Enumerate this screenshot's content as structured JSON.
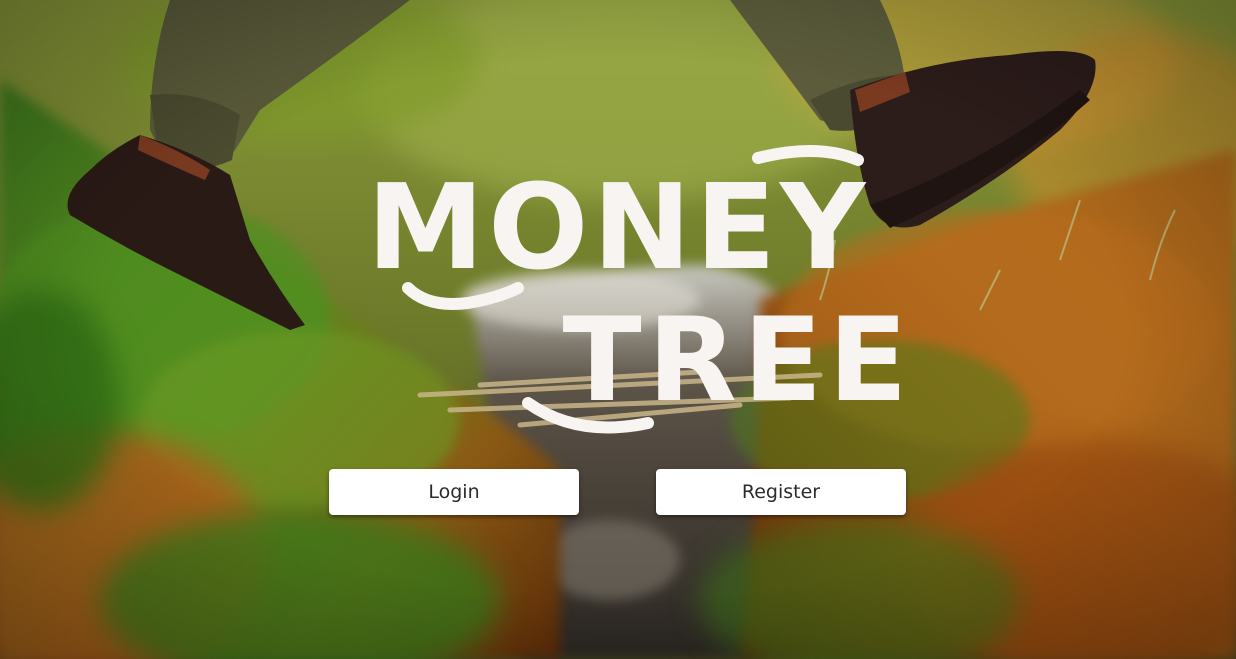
{
  "brand": {
    "line1": "MONEY",
    "line2": "TREE",
    "colors": {
      "logo": "#f7f4f1"
    }
  },
  "actions": {
    "login_label": "Login",
    "register_label": "Register"
  }
}
